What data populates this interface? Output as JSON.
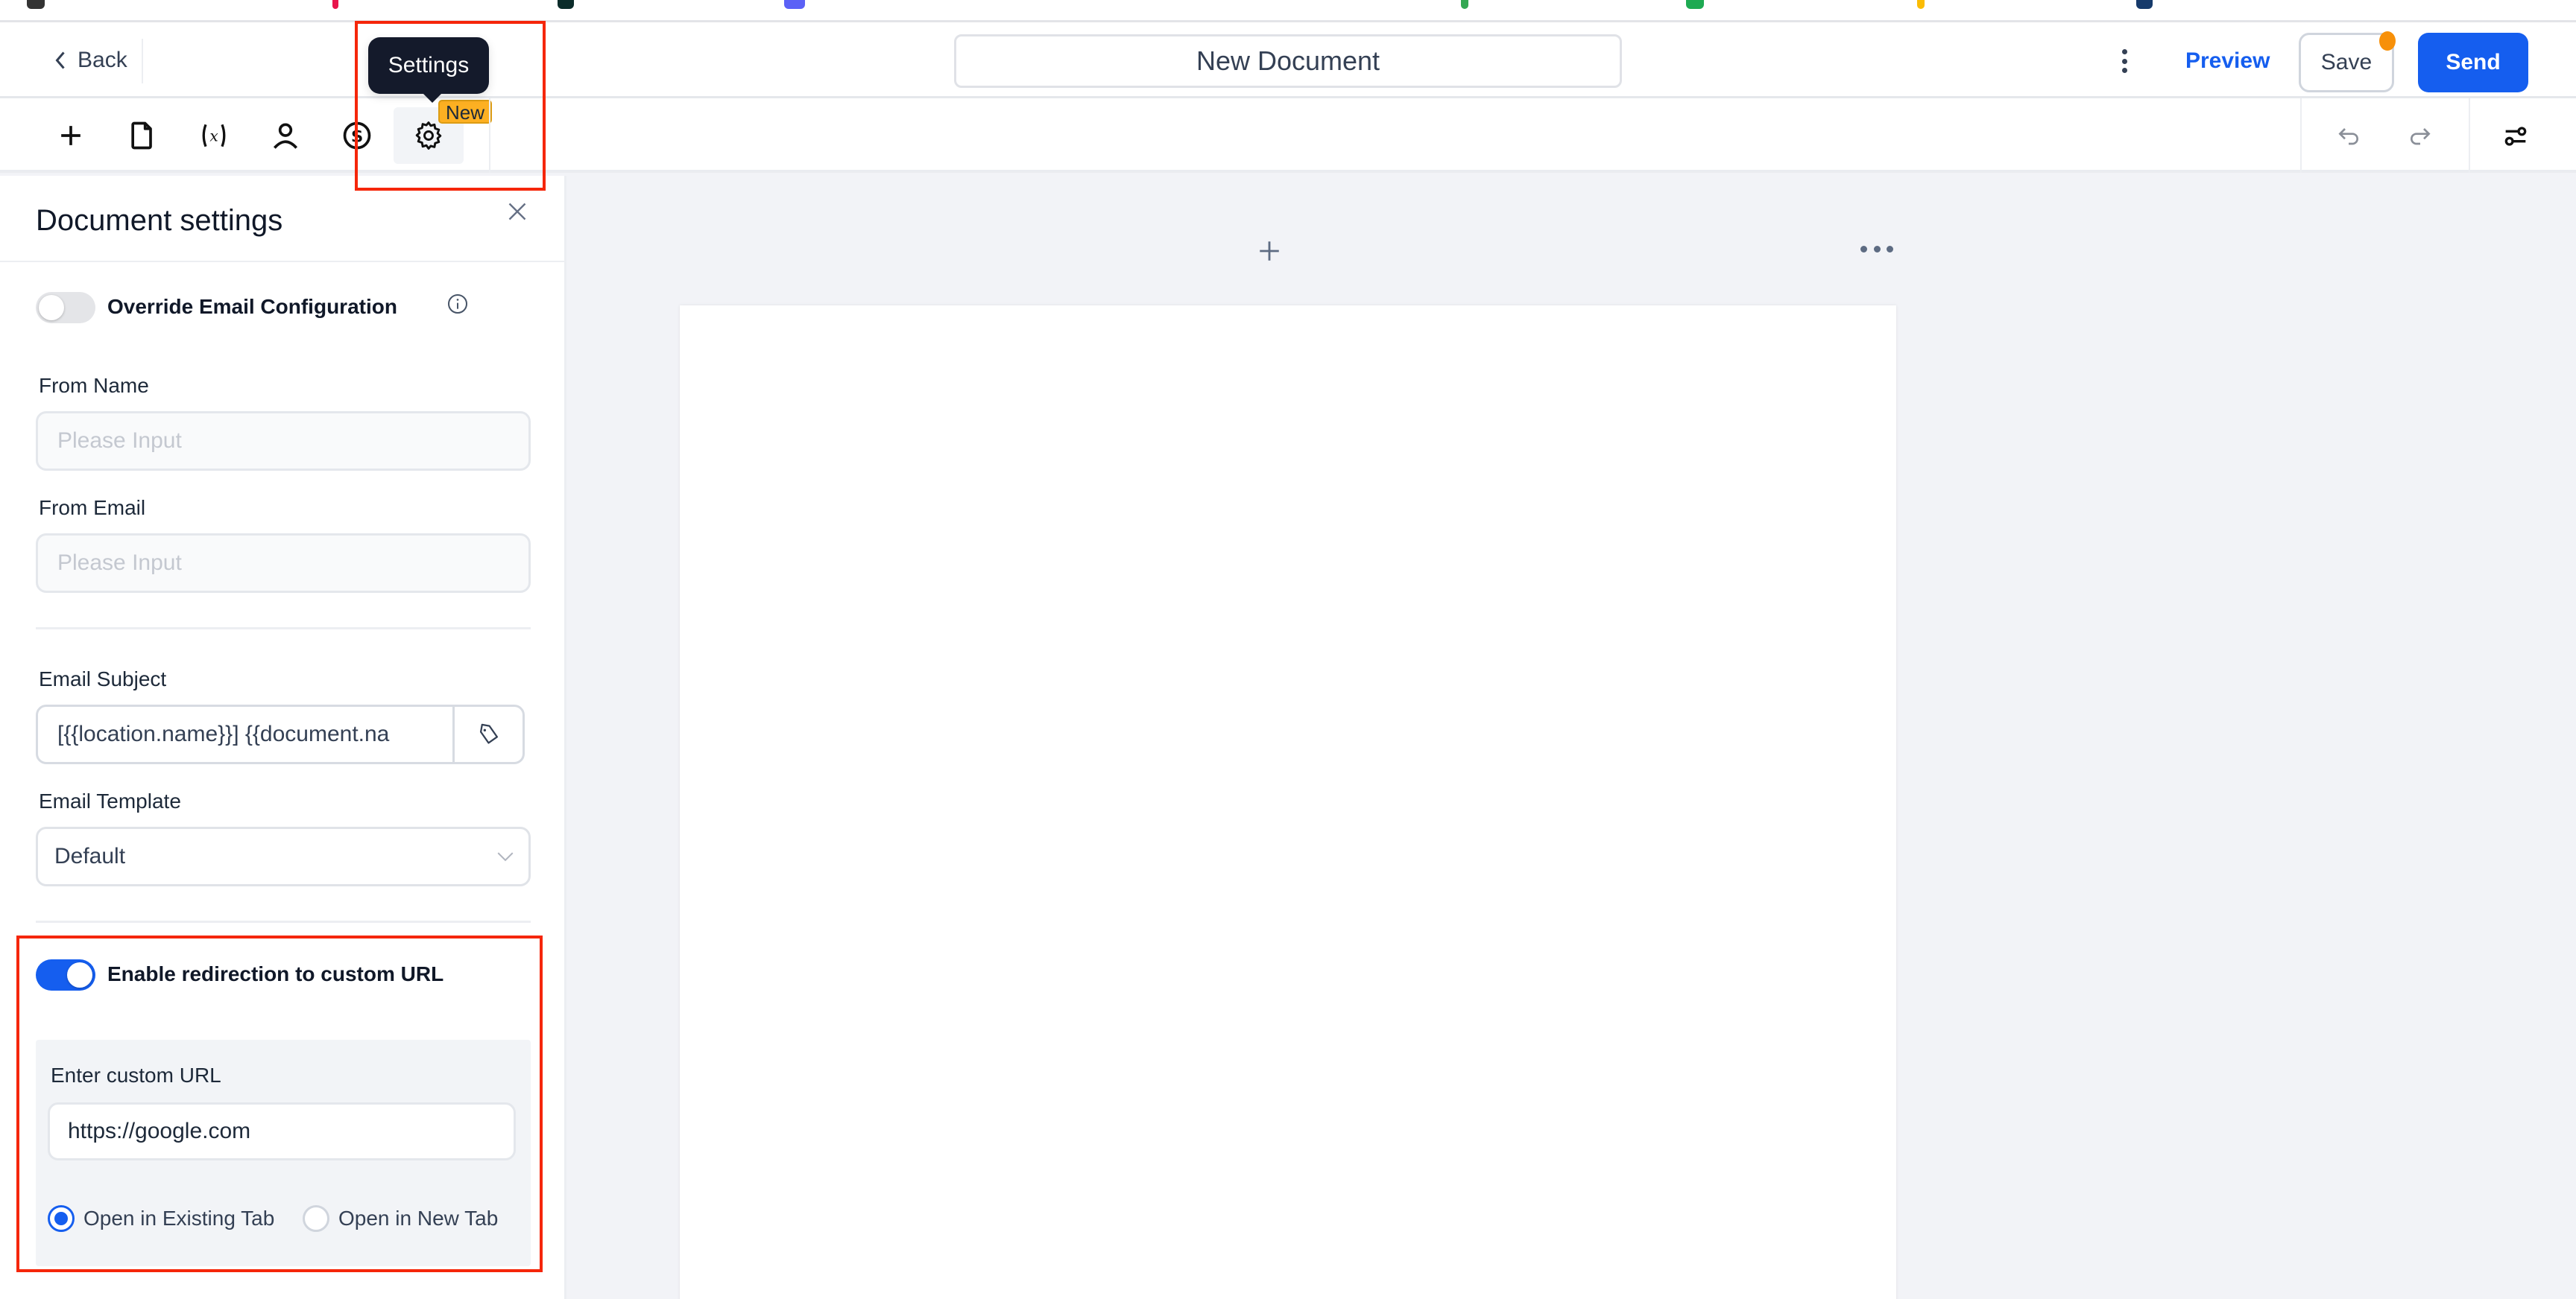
{
  "header": {
    "back_label": "Back",
    "document_title": "New Document",
    "preview_label": "Preview",
    "save_label": "Save",
    "send_label": "Send",
    "unsaved_indicator_color": "#f79009"
  },
  "toolbar": {
    "tools": [
      {
        "name": "add",
        "icon": "plus-icon"
      },
      {
        "name": "pages",
        "icon": "document-icon"
      },
      {
        "name": "variables",
        "icon": "variable-icon"
      },
      {
        "name": "recipients",
        "icon": "user-icon"
      },
      {
        "name": "pricing",
        "icon": "dollar-icon"
      },
      {
        "name": "settings",
        "icon": "gear-icon",
        "active": true
      }
    ],
    "settings_tooltip": "Settings",
    "new_badge": "New",
    "undo_icon": "undo-icon",
    "redo_icon": "redo-icon",
    "options_icon": "sliders-icon"
  },
  "panel": {
    "title": "Document settings",
    "override_email": {
      "label": "Override Email Configuration",
      "enabled": false
    },
    "from_name": {
      "label": "From Name",
      "value": "",
      "placeholder": "Please Input"
    },
    "from_email": {
      "label": "From Email",
      "value": "",
      "placeholder": "Please Input"
    },
    "email_subject": {
      "label": "Email Subject",
      "value": "[{{location.name}}] {{document.na"
    },
    "email_template": {
      "label": "Email Template",
      "selected": "Default"
    },
    "redirection": {
      "label": "Enable redirection to custom URL",
      "enabled": true,
      "url_label": "Enter custom URL",
      "url_value": "https://google.com",
      "options": [
        {
          "label": "Open in Existing Tab",
          "checked": true
        },
        {
          "label": "Open in New Tab",
          "checked": false
        }
      ]
    }
  },
  "colors": {
    "accent": "#155eef",
    "annotation": "#f5260a",
    "badge": "#fdb022",
    "tooltip_bg": "#141a2b"
  }
}
